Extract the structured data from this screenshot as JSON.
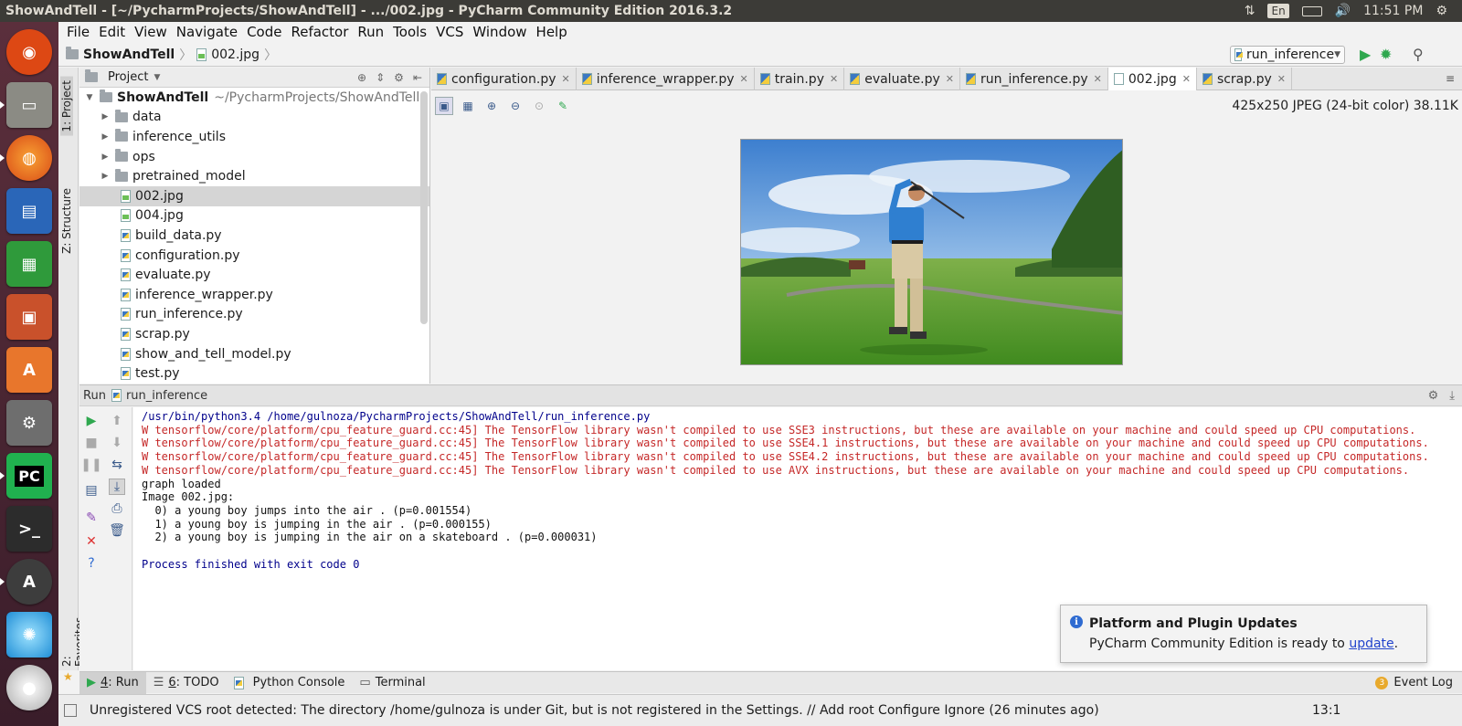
{
  "system": {
    "window_title": "ShowAndTell - [~/PycharmProjects/ShowAndTell] - .../002.jpg - PyCharm Community Edition 2016.3.2",
    "language": "En",
    "clock": "11:51 PM"
  },
  "launcher": {
    "apps": [
      "ubuntu-dash",
      "files",
      "firefox",
      "libreoffice-writer",
      "libreoffice-calc",
      "libreoffice-impress",
      "ubuntu-software",
      "system-settings",
      "pycharm",
      "terminal",
      "software-updater",
      "screenshot",
      "dvd"
    ]
  },
  "menu": [
    "File",
    "Edit",
    "View",
    "Navigate",
    "Code",
    "Refactor",
    "Run",
    "Tools",
    "VCS",
    "Window",
    "Help"
  ],
  "navbar": {
    "project": "ShowAndTell",
    "file": "002.jpg",
    "run_config": "run_inference"
  },
  "side_tabs": {
    "project": "1: Project",
    "structure": "Z: Structure",
    "favorites": "2: Favorites"
  },
  "project_panel": {
    "title": "Project",
    "root": "ShowAndTell",
    "root_path": "~/PycharmProjects/ShowAndTell",
    "items": [
      {
        "label": "data",
        "kind": "folder"
      },
      {
        "label": "inference_utils",
        "kind": "folder"
      },
      {
        "label": "ops",
        "kind": "folder"
      },
      {
        "label": "pretrained_model",
        "kind": "folder"
      },
      {
        "label": "002.jpg",
        "kind": "image",
        "selected": true
      },
      {
        "label": "004.jpg",
        "kind": "image"
      },
      {
        "label": "build_data.py",
        "kind": "py"
      },
      {
        "label": "configuration.py",
        "kind": "py"
      },
      {
        "label": "evaluate.py",
        "kind": "py"
      },
      {
        "label": "inference_wrapper.py",
        "kind": "py"
      },
      {
        "label": "run_inference.py",
        "kind": "py"
      },
      {
        "label": "scrap.py",
        "kind": "py"
      },
      {
        "label": "show_and_tell_model.py",
        "kind": "py"
      },
      {
        "label": "test.py",
        "kind": "py"
      }
    ]
  },
  "editor_tabs": [
    {
      "label": "configuration.py",
      "kind": "py"
    },
    {
      "label": "inference_wrapper.py",
      "kind": "py"
    },
    {
      "label": "train.py",
      "kind": "py"
    },
    {
      "label": "evaluate.py",
      "kind": "py"
    },
    {
      "label": "run_inference.py",
      "kind": "py"
    },
    {
      "label": "002.jpg",
      "kind": "image",
      "active": true
    },
    {
      "label": "scrap.py",
      "kind": "py"
    }
  ],
  "image_viewer": {
    "info": "425x250 JPEG (24-bit color) 38.11K"
  },
  "run_panel": {
    "label": "Run",
    "config": "run_inference",
    "console": {
      "command": "/usr/bin/python3.4 /home/gulnoza/PycharmProjects/ShowAndTell/run_inference.py",
      "warnings": [
        "W tensorflow/core/platform/cpu_feature_guard.cc:45] The TensorFlow library wasn't compiled to use SSE3 instructions, but these are available on your machine and could speed up CPU computations.",
        "W tensorflow/core/platform/cpu_feature_guard.cc:45] The TensorFlow library wasn't compiled to use SSE4.1 instructions, but these are available on your machine and could speed up CPU computations.",
        "W tensorflow/core/platform/cpu_feature_guard.cc:45] The TensorFlow library wasn't compiled to use SSE4.2 instructions, but these are available on your machine and could speed up CPU computations.",
        "W tensorflow/core/platform/cpu_feature_guard.cc:45] The TensorFlow library wasn't compiled to use AVX instructions, but these are available on your machine and could speed up CPU computations."
      ],
      "output": [
        "graph loaded",
        "Image 002.jpg:",
        "  0) a young boy jumps into the air . (p=0.001554)",
        "  1) a young boy is jumping in the air . (p=0.000155)",
        "  2) a young boy is jumping in the air on a skateboard . (p=0.000031)"
      ],
      "finish": "Process finished with exit code 0"
    }
  },
  "notification": {
    "title": "Platform and Plugin Updates",
    "body": "PyCharm Community Edition is ready to ",
    "link": "update",
    "tail": "."
  },
  "tool_windows": {
    "run_num": "4",
    "run_label": ": Run",
    "todo_num": "6",
    "todo_label": ": TODO",
    "python_console": "Python Console",
    "terminal": "Terminal",
    "event_count": "3",
    "event_log": "Event Log"
  },
  "status": {
    "message": "Unregistered VCS root detected: The directory /home/gulnoza is under Git, but is not registered in the Settings. // Add root  Configure  Ignore (26 minutes ago)",
    "position": "13:1"
  }
}
